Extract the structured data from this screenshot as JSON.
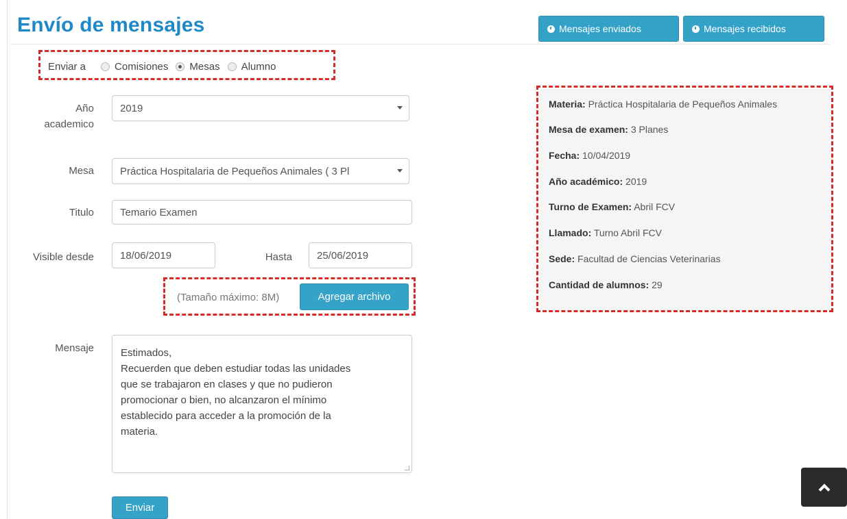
{
  "page": {
    "title": "Envío de mensajes"
  },
  "header_buttons": {
    "sent": "Mensajes enviados",
    "received": "Mensajes recibidos"
  },
  "send_to": {
    "label": "Enviar a",
    "options": [
      "Comisiones",
      "Mesas",
      "Alumno"
    ],
    "selected": "Mesas"
  },
  "form": {
    "year_label_line1": "Año",
    "year_label_line2": "academico",
    "year_value": "2019",
    "mesa_label": "Mesa",
    "mesa_value": "Práctica Hospitalaria de Pequeños Animales ( 3 Pl",
    "title_label": "Titulo",
    "title_value": "Temario Examen",
    "visible_from_label": "Visible desde",
    "visible_from_value": "18/06/2019",
    "until_label": "Hasta",
    "until_value": "25/06/2019",
    "max_size_note": "(Tamaño máximo: 8M)",
    "attach_button": "Agregar archivo",
    "message_label": "Mensaje",
    "message_lines": [
      "Estimados,",
      "Recuerden que deben estudiar todas las unidades",
      "que se trabajaron en clases y que no pudieron",
      "promocionar o bien, no alcanzaron el mínimo",
      "establecido para acceder a la promoción de la",
      "materia."
    ],
    "send_button": "Enviar"
  },
  "info": [
    {
      "label": "Materia:",
      "value": "Práctica Hospitalaria de Pequeños Animales"
    },
    {
      "label": "Mesa de examen:",
      "value": "3 Planes"
    },
    {
      "label": "Fecha:",
      "value": "10/04/2019"
    },
    {
      "label": "Año académico:",
      "value": "2019"
    },
    {
      "label": "Turno de Examen:",
      "value": "Abril FCV"
    },
    {
      "label": "Llamado:",
      "value": "Turno Abril FCV"
    },
    {
      "label": "Sede:",
      "value": "Facultad de Ciencias Veterinarias"
    },
    {
      "label": "Cantidad de alumnos:",
      "value": "29"
    }
  ],
  "icons": {
    "header_button": "clock-icon",
    "scroll_top": "chevron-up-icon"
  },
  "colors": {
    "accent": "#34a2c7",
    "title": "#1f88c6",
    "highlight": "#d42a2a"
  }
}
